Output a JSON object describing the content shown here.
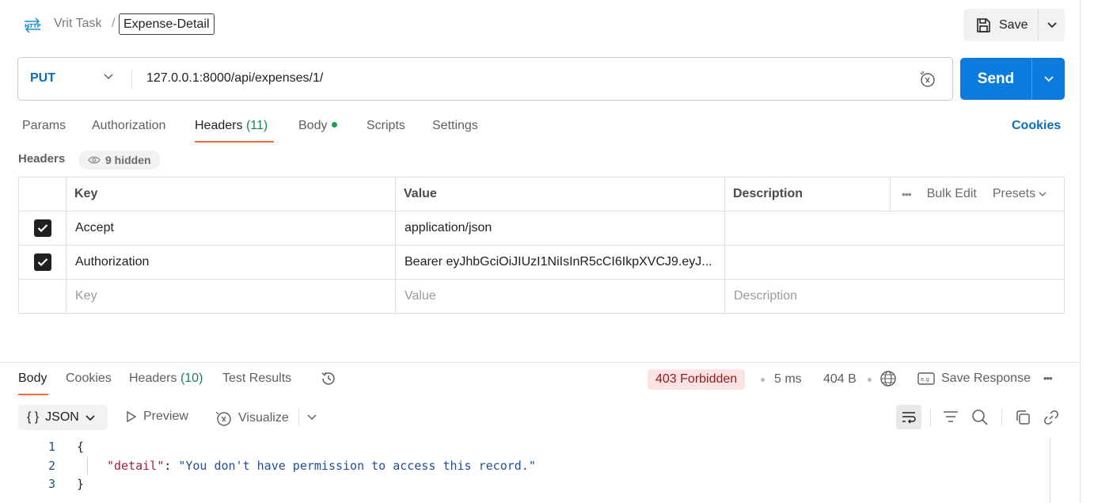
{
  "breadcrumb": {
    "icon": "http-icon",
    "parent": "Vrit Task",
    "separator": "/",
    "current": "Expense-Detail"
  },
  "save": {
    "label": "Save"
  },
  "request": {
    "method": "PUT",
    "url": "127.0.0.1:8000/api/expenses/1/",
    "send_label": "Send"
  },
  "request_tabs": {
    "params": "Params",
    "authorization": "Authorization",
    "headers": "Headers",
    "headers_count": "(11)",
    "body": "Body",
    "scripts": "Scripts",
    "settings": "Settings",
    "cookies": "Cookies",
    "active": "headers"
  },
  "headers_section": {
    "title": "Headers",
    "hidden": "9 hidden",
    "columns": {
      "key": "Key",
      "value": "Value",
      "description": "Description"
    },
    "bulk_edit": "Bulk Edit",
    "presets": "Presets",
    "rows": [
      {
        "checked": true,
        "key": "Accept",
        "value": "application/json",
        "description": ""
      },
      {
        "checked": true,
        "key": "Authorization",
        "value": "Bearer eyJhbGciOiJIUzI1NiIsInR5cCI6IkpXVCJ9.eyJ...",
        "description": ""
      }
    ],
    "placeholders": {
      "key": "Key",
      "value": "Value",
      "description": "Description"
    }
  },
  "response": {
    "tabs": {
      "body": "Body",
      "cookies": "Cookies",
      "headers": "Headers",
      "headers_count": "(10)",
      "test_results": "Test Results",
      "active": "body"
    },
    "status": "403 Forbidden",
    "time": "5 ms",
    "size": "404 B",
    "save_response": "Save Response",
    "format": "JSON",
    "preview": "Preview",
    "visualize": "Visualize",
    "lines": [
      {
        "no": "1",
        "text": "{"
      },
      {
        "no": "2",
        "key": "\"detail\"",
        "colon": ": ",
        "value": "\"You don't have permission to access this record.\""
      },
      {
        "no": "3",
        "text": "}"
      }
    ]
  },
  "colors": {
    "send": "#0b7bde",
    "method": "#0b6fb8",
    "tab_accent": "#f26b3a",
    "status_bg": "#fbe3e3",
    "status_text": "#8e1b1b",
    "count_green": "#16835a"
  }
}
